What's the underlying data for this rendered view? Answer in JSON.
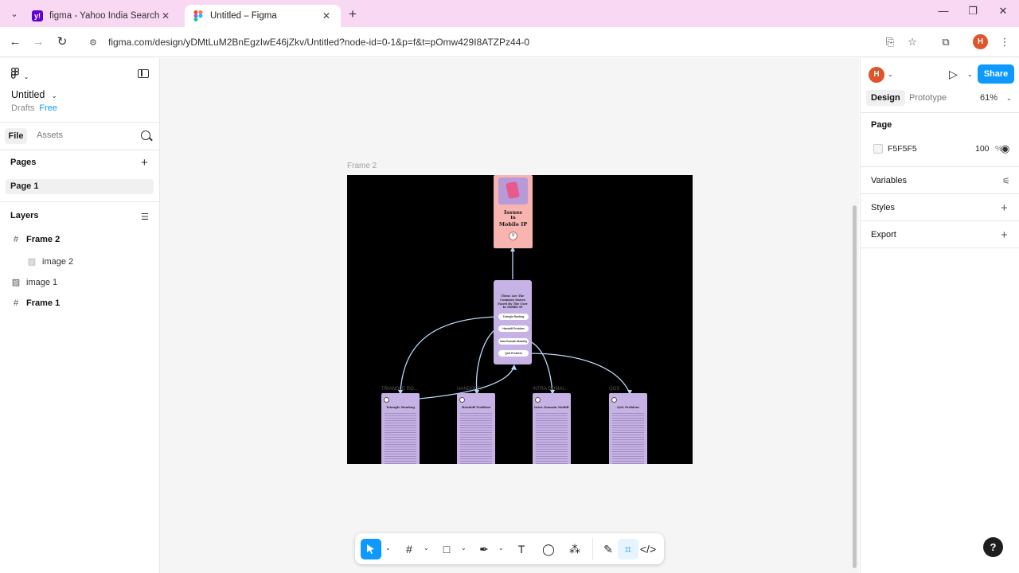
{
  "browser": {
    "tabs": [
      {
        "title": "figma - Yahoo India Search Res",
        "favicon": "yahoo-icon",
        "active": false
      },
      {
        "title": "Untitled – Figma",
        "favicon": "figma-icon",
        "active": true
      }
    ],
    "url": "figma.com/design/yDMtLuM2BnEgzIwE46jZkv/Untitled?node-id=0-1&p=f&t=pOmw429I8ATZPz44-0",
    "profile_initial": "H"
  },
  "left_panel": {
    "file_title": "Untitled",
    "location": "Drafts",
    "plan": "Free",
    "tabs": {
      "file": "File",
      "assets": "Assets"
    },
    "pages_heading": "Pages",
    "pages": [
      "Page 1"
    ],
    "layers_heading": "Layers",
    "layers": [
      {
        "name": "Frame 2",
        "icon": "frame-icon",
        "indent": 0,
        "bold": true
      },
      {
        "name": "image 2",
        "icon": "image-icon",
        "indent": 1,
        "bold": false
      },
      {
        "name": "image 1",
        "icon": "image-icon",
        "indent": 0,
        "bold": false
      },
      {
        "name": "Frame 1",
        "icon": "frame-icon",
        "indent": 0,
        "bold": true
      }
    ]
  },
  "canvas": {
    "frame_label": "Frame 2",
    "background": "#F5F5F5",
    "diagram": {
      "top_node": {
        "line1": "Issues",
        "line2": "In",
        "line3": "Mobile IP"
      },
      "mid_node": {
        "heading": "These Are The Common Issues Faced By The User In Mobile IP",
        "items": [
          "Triangle Routing",
          "Handoff Problem",
          "Intra Domain Mobility",
          "QoS Problem"
        ]
      },
      "cards": [
        {
          "tag": "TRIANGLE RO...",
          "title": "Triangle Routing"
        },
        {
          "tag": "HANDOFF...",
          "title": "Handoff Problem"
        },
        {
          "tag": "INTRA DOMAI...",
          "title": "Intra Domain Mobility"
        },
        {
          "tag": "QOS",
          "title": "QoS Problem"
        }
      ]
    }
  },
  "toolbar": {
    "tools": [
      "move-tool",
      "frame-tool",
      "rectangle-tool",
      "pen-tool",
      "text-tool",
      "comment-tool",
      "actions-tool",
      "draw-mode",
      "design-mode",
      "dev-mode"
    ]
  },
  "right_panel": {
    "profile_initial": "H",
    "share_label": "Share",
    "tabs": {
      "design": "Design",
      "prototype": "Prototype"
    },
    "zoom": "61%",
    "page_heading": "Page",
    "page_color": "F5F5F5",
    "page_opacity": "100",
    "percent_sign": "%",
    "variables_label": "Variables",
    "styles_label": "Styles",
    "export_label": "Export",
    "help_label": "?"
  }
}
